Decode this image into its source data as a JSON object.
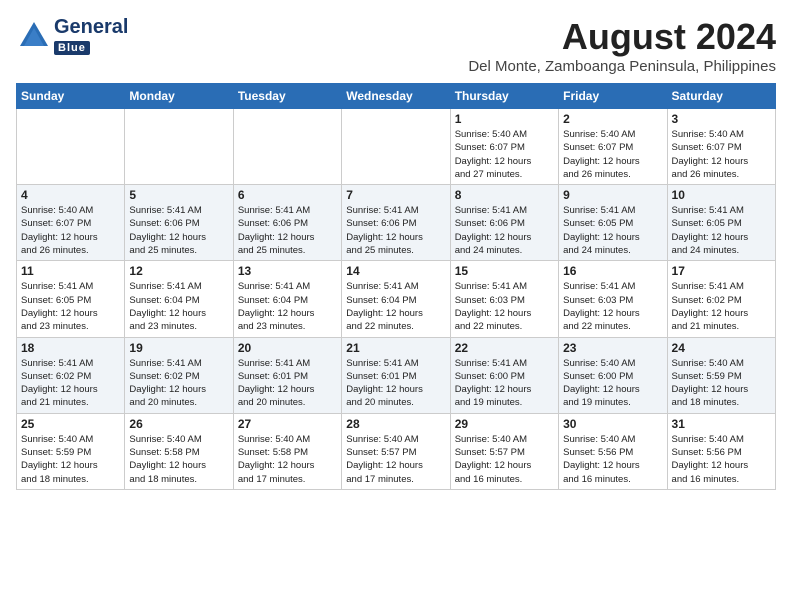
{
  "logo": {
    "general": "General",
    "blue": "Blue"
  },
  "title": "August 2024",
  "subtitle": "Del Monte, Zamboanga Peninsula, Philippines",
  "headers": [
    "Sunday",
    "Monday",
    "Tuesday",
    "Wednesday",
    "Thursday",
    "Friday",
    "Saturday"
  ],
  "weeks": [
    [
      {
        "day": "",
        "info": ""
      },
      {
        "day": "",
        "info": ""
      },
      {
        "day": "",
        "info": ""
      },
      {
        "day": "",
        "info": ""
      },
      {
        "day": "1",
        "info": "Sunrise: 5:40 AM\nSunset: 6:07 PM\nDaylight: 12 hours\nand 27 minutes."
      },
      {
        "day": "2",
        "info": "Sunrise: 5:40 AM\nSunset: 6:07 PM\nDaylight: 12 hours\nand 26 minutes."
      },
      {
        "day": "3",
        "info": "Sunrise: 5:40 AM\nSunset: 6:07 PM\nDaylight: 12 hours\nand 26 minutes."
      }
    ],
    [
      {
        "day": "4",
        "info": "Sunrise: 5:40 AM\nSunset: 6:07 PM\nDaylight: 12 hours\nand 26 minutes."
      },
      {
        "day": "5",
        "info": "Sunrise: 5:41 AM\nSunset: 6:06 PM\nDaylight: 12 hours\nand 25 minutes."
      },
      {
        "day": "6",
        "info": "Sunrise: 5:41 AM\nSunset: 6:06 PM\nDaylight: 12 hours\nand 25 minutes."
      },
      {
        "day": "7",
        "info": "Sunrise: 5:41 AM\nSunset: 6:06 PM\nDaylight: 12 hours\nand 25 minutes."
      },
      {
        "day": "8",
        "info": "Sunrise: 5:41 AM\nSunset: 6:06 PM\nDaylight: 12 hours\nand 24 minutes."
      },
      {
        "day": "9",
        "info": "Sunrise: 5:41 AM\nSunset: 6:05 PM\nDaylight: 12 hours\nand 24 minutes."
      },
      {
        "day": "10",
        "info": "Sunrise: 5:41 AM\nSunset: 6:05 PM\nDaylight: 12 hours\nand 24 minutes."
      }
    ],
    [
      {
        "day": "11",
        "info": "Sunrise: 5:41 AM\nSunset: 6:05 PM\nDaylight: 12 hours\nand 23 minutes."
      },
      {
        "day": "12",
        "info": "Sunrise: 5:41 AM\nSunset: 6:04 PM\nDaylight: 12 hours\nand 23 minutes."
      },
      {
        "day": "13",
        "info": "Sunrise: 5:41 AM\nSunset: 6:04 PM\nDaylight: 12 hours\nand 23 minutes."
      },
      {
        "day": "14",
        "info": "Sunrise: 5:41 AM\nSunset: 6:04 PM\nDaylight: 12 hours\nand 22 minutes."
      },
      {
        "day": "15",
        "info": "Sunrise: 5:41 AM\nSunset: 6:03 PM\nDaylight: 12 hours\nand 22 minutes."
      },
      {
        "day": "16",
        "info": "Sunrise: 5:41 AM\nSunset: 6:03 PM\nDaylight: 12 hours\nand 22 minutes."
      },
      {
        "day": "17",
        "info": "Sunrise: 5:41 AM\nSunset: 6:02 PM\nDaylight: 12 hours\nand 21 minutes."
      }
    ],
    [
      {
        "day": "18",
        "info": "Sunrise: 5:41 AM\nSunset: 6:02 PM\nDaylight: 12 hours\nand 21 minutes."
      },
      {
        "day": "19",
        "info": "Sunrise: 5:41 AM\nSunset: 6:02 PM\nDaylight: 12 hours\nand 20 minutes."
      },
      {
        "day": "20",
        "info": "Sunrise: 5:41 AM\nSunset: 6:01 PM\nDaylight: 12 hours\nand 20 minutes."
      },
      {
        "day": "21",
        "info": "Sunrise: 5:41 AM\nSunset: 6:01 PM\nDaylight: 12 hours\nand 20 minutes."
      },
      {
        "day": "22",
        "info": "Sunrise: 5:41 AM\nSunset: 6:00 PM\nDaylight: 12 hours\nand 19 minutes."
      },
      {
        "day": "23",
        "info": "Sunrise: 5:40 AM\nSunset: 6:00 PM\nDaylight: 12 hours\nand 19 minutes."
      },
      {
        "day": "24",
        "info": "Sunrise: 5:40 AM\nSunset: 5:59 PM\nDaylight: 12 hours\nand 18 minutes."
      }
    ],
    [
      {
        "day": "25",
        "info": "Sunrise: 5:40 AM\nSunset: 5:59 PM\nDaylight: 12 hours\nand 18 minutes."
      },
      {
        "day": "26",
        "info": "Sunrise: 5:40 AM\nSunset: 5:58 PM\nDaylight: 12 hours\nand 18 minutes."
      },
      {
        "day": "27",
        "info": "Sunrise: 5:40 AM\nSunset: 5:58 PM\nDaylight: 12 hours\nand 17 minutes."
      },
      {
        "day": "28",
        "info": "Sunrise: 5:40 AM\nSunset: 5:57 PM\nDaylight: 12 hours\nand 17 minutes."
      },
      {
        "day": "29",
        "info": "Sunrise: 5:40 AM\nSunset: 5:57 PM\nDaylight: 12 hours\nand 16 minutes."
      },
      {
        "day": "30",
        "info": "Sunrise: 5:40 AM\nSunset: 5:56 PM\nDaylight: 12 hours\nand 16 minutes."
      },
      {
        "day": "31",
        "info": "Sunrise: 5:40 AM\nSunset: 5:56 PM\nDaylight: 12 hours\nand 16 minutes."
      }
    ]
  ]
}
